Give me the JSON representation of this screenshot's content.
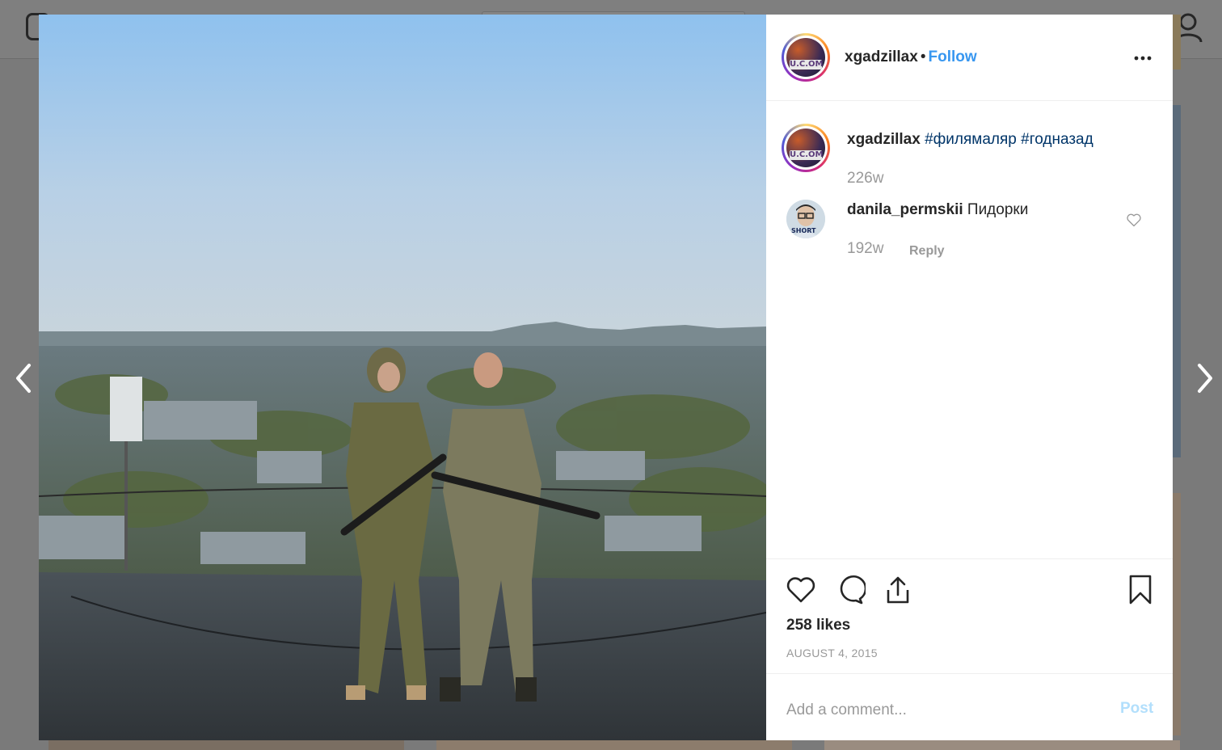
{
  "post": {
    "author": "xgadzillax",
    "separator": "•",
    "follow_label": "Follow",
    "avatar_badge": "U.C.OM",
    "caption": {
      "username": "xgadzillax",
      "hashtags": [
        "#филямаляр",
        "#годназад"
      ],
      "age": "226w"
    },
    "comments": [
      {
        "username": "danila_permskii",
        "text": "Пидорки",
        "age": "192w",
        "reply_label": "Reply",
        "avatar_text": "SHORT"
      }
    ],
    "likes": "258 likes",
    "date": "AUGUST 4, 2015",
    "comment_placeholder": "Add a comment...",
    "post_label": "Post"
  },
  "icons": {
    "like": "heart-icon",
    "comment": "comment-bubble-icon",
    "share": "share-icon",
    "save": "bookmark-icon",
    "more": "more-options-icon",
    "prev": "chevron-left-icon",
    "next": "chevron-right-icon"
  },
  "colors": {
    "link": "#3897f0",
    "hashtag": "#003569",
    "muted": "#999999",
    "post_disabled": "#b2dffc"
  }
}
